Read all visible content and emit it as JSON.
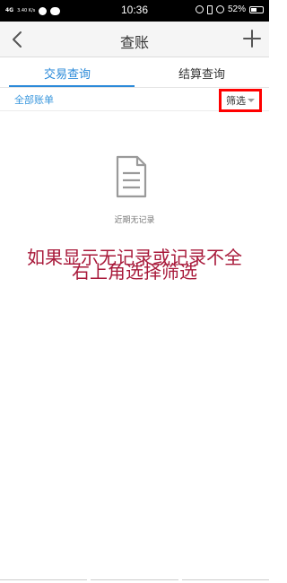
{
  "status_bar": {
    "network": "4G",
    "speed": "3.40 K/s",
    "time": "10:36",
    "battery": "52%",
    "battery_level": 0.52
  },
  "nav": {
    "title": "查账",
    "back_icon": "chevron-left-icon",
    "add_icon": "plus-icon"
  },
  "tabs": [
    {
      "label": "交易查询",
      "active": true
    },
    {
      "label": "结算查询",
      "active": false
    }
  ],
  "filter_row": {
    "all_bills": "全部账单",
    "filter_label": "筛选"
  },
  "empty_state": {
    "icon": "document-icon",
    "text": "近期无记录"
  },
  "annotation": {
    "line1": "如果显示无记录或记录不全",
    "line2": "右上角选择筛选",
    "color": "#a8193a"
  },
  "colors": {
    "accent": "#2b8ad9",
    "highlight_box": "#ff0000"
  }
}
